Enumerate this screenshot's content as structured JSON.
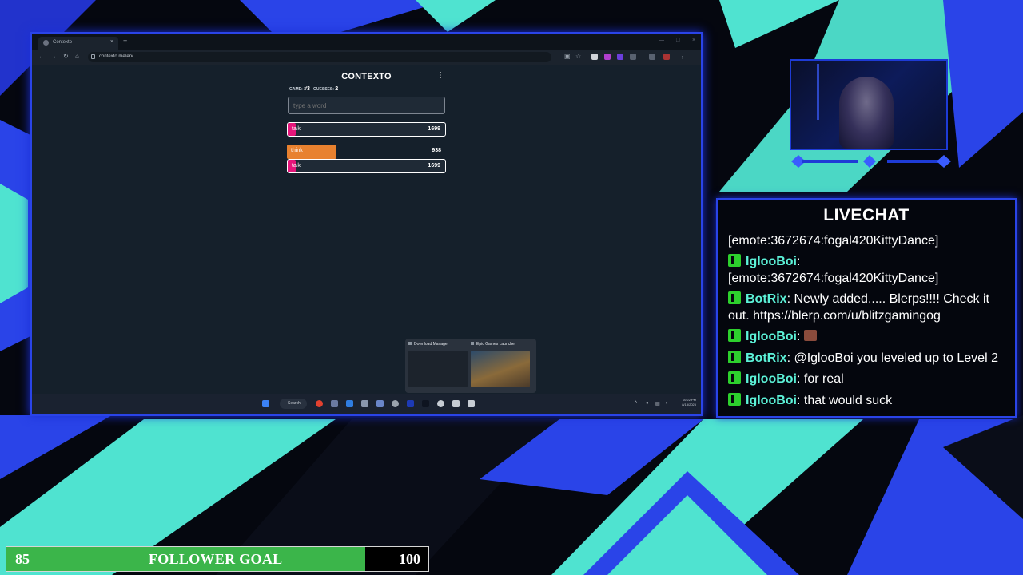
{
  "colors": {
    "accent_blue": "#2a44e8",
    "accent_teal": "#4fe3d0",
    "chat_user": "#5cf2d8",
    "kick_green": "#2dd02d",
    "goal_green": "#3bb54a",
    "contexto_pink": "#e5157a",
    "contexto_orange": "#e8812f"
  },
  "browser": {
    "tab_title": "Contexto",
    "url": "contexto.me/en/",
    "nav_icons": [
      "back-icon",
      "forward-icon",
      "reload-icon",
      "home-icon"
    ]
  },
  "contexto": {
    "title": "CONTEXTO",
    "game_label": "GAME:",
    "game_number": "#3",
    "guesses_label": "GUESSES:",
    "guesses_count": "2",
    "input_placeholder": "type a word",
    "last_guess": {
      "word": "talk",
      "distance": "1699",
      "closeness": 0.05,
      "color": "#e5157a"
    },
    "guesses": [
      {
        "word": "think",
        "distance": "938",
        "closeness": 0.31,
        "color": "#e8812f"
      },
      {
        "word": "talk",
        "distance": "1699",
        "closeness": 0.05,
        "color": "#e5157a"
      }
    ]
  },
  "taskbar": {
    "search_label": "Search",
    "clock_time": "10:22 PM",
    "clock_date": "8/13/2025",
    "previews": [
      {
        "title": "Download Manager"
      },
      {
        "title": "Epic Games Launcher"
      }
    ]
  },
  "livechat": {
    "title": "LIVECHAT",
    "messages": [
      {
        "user": "",
        "text": "[emote:3672674:fogal420KittyDance]"
      },
      {
        "user": "IglooBoi",
        "text": "[emote:3672674:fogal420KittyDance]"
      },
      {
        "user": "BotRix",
        "text": "Newly added..... Blerps!!!! Check it out. https://blerp.com/u/blitzgamingog"
      },
      {
        "user": "IglooBoi",
        "text": ""
      },
      {
        "user": "BotRix",
        "text": "@IglooBoi you leveled up to Level 2"
      },
      {
        "user": "IglooBoi",
        "text": "for real"
      },
      {
        "user": "IglooBoi",
        "text": "that would suck"
      }
    ]
  },
  "follower_goal": {
    "current": "85",
    "label": "FOLLOWER GOAL",
    "target": "100",
    "progress": 0.85
  }
}
